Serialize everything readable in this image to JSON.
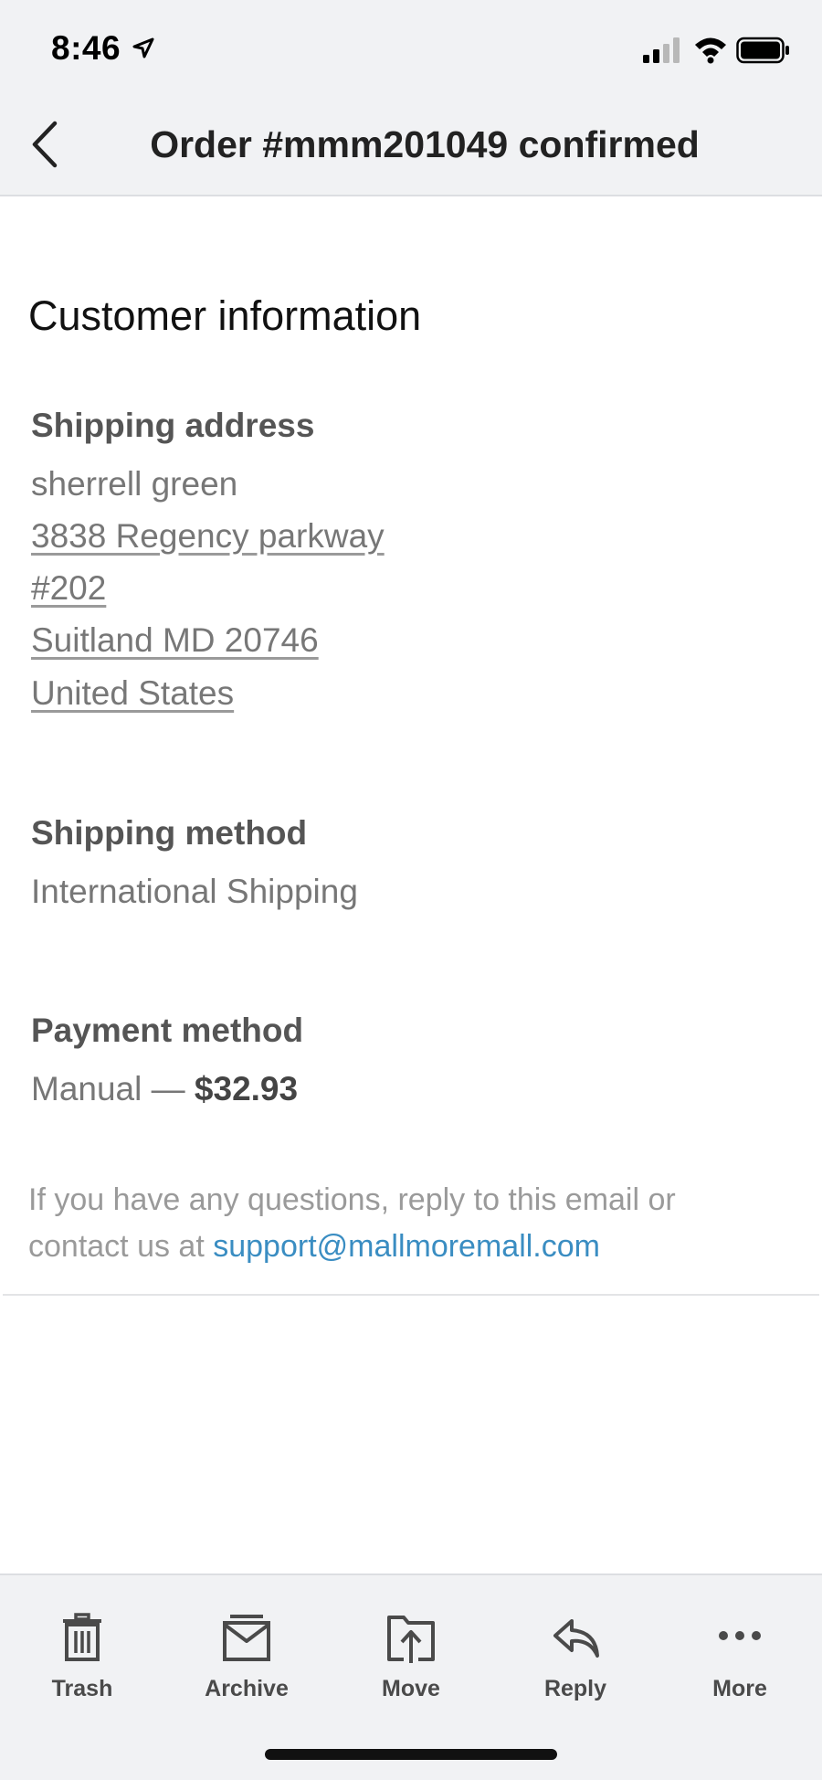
{
  "status_bar": {
    "time": "8:46"
  },
  "nav": {
    "title": "Order #mmm201049 confirmed"
  },
  "customer": {
    "section_title": "Customer information",
    "shipping_address_label": "Shipping address",
    "address_lines": [
      "sherrell green",
      "3838 Regency parkway",
      "#202",
      "Suitland MD 20746",
      "United States"
    ],
    "shipping_method_label": "Shipping method",
    "shipping_method_value": "International Shipping",
    "payment_method_label": "Payment method",
    "payment_method_prefix": "Manual — ",
    "payment_amount": "$32.93"
  },
  "footer": {
    "text_line1": "If you have any questions, reply to this email or",
    "text_line2_prefix": "contact us at ",
    "email": "support@mallmoremall.com"
  },
  "toolbar": {
    "items": [
      {
        "label": "Trash",
        "icon": "trash-icon"
      },
      {
        "label": "Archive",
        "icon": "archive-icon"
      },
      {
        "label": "Move",
        "icon": "move-icon"
      },
      {
        "label": "Reply",
        "icon": "reply-icon"
      },
      {
        "label": "More",
        "icon": "more-icon"
      }
    ]
  },
  "colors": {
    "link": "#3a8dc2",
    "bar_bg": "#f1f2f4",
    "muted_text": "#777777"
  }
}
